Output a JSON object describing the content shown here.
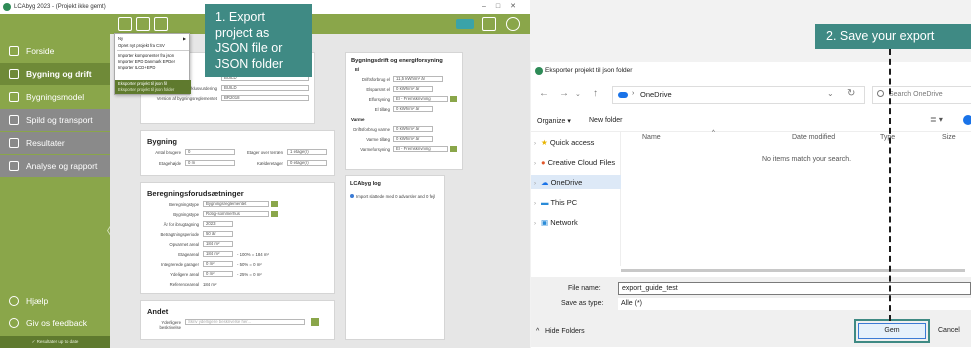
{
  "app": {
    "window_title": "LCAbyg 2023 - (Projekt ikke gemt)",
    "window_controls": [
      "–",
      "□",
      "✕"
    ],
    "sidebar_items": [
      {
        "label": "Forside",
        "icon": "home-icon"
      },
      {
        "label": "Bygning og drift",
        "icon": "building-icon"
      },
      {
        "label": "Bygningsmodel",
        "icon": "model-icon"
      },
      {
        "label": "Spild og transport",
        "icon": "truck-icon"
      },
      {
        "label": "Resultater",
        "icon": "table-icon"
      },
      {
        "label": "Analyse og rapport",
        "icon": "chart-icon"
      }
    ],
    "sidebar_bottom": [
      {
        "label": "Hjælp",
        "icon": "help-icon"
      },
      {
        "label": "Giv os feedback",
        "icon": "feedback-icon"
      }
    ],
    "collapse_glyph": "〈",
    "status_footer": "✓ Resultater up to date",
    "file_menu": {
      "items": [
        "Ny",
        "Opret nyt projekt fra CSV",
        "Importer komponenter fra json",
        "Importer EPD Danmark EPDer",
        "Importer ILCD+EPD",
        "Eksporter projekt til json fil",
        "Eksporter projekt til json folder"
      ]
    },
    "panels": {
      "project": {
        "fields": [
          {
            "label": "",
            "value": "Pilevej 99, 9999 Prombbibyen"
          },
          {
            "label": "",
            "value": "BUILD"
          },
          {
            "label": "Ansvarlig for livscyklusvurdering",
            "value": "BUILD"
          },
          {
            "label": "Version af bygningsreglementet",
            "value": "BR2018"
          }
        ]
      },
      "bygning": {
        "title": "Bygning",
        "fields": [
          {
            "label": "Antal brugere",
            "value": "0"
          },
          {
            "label": "Etager over terræn",
            "value": "1 etage(r)"
          },
          {
            "label": "Etagehøjde",
            "value": "0 m"
          },
          {
            "label": "Kælderetager",
            "value": "0 etage(r)"
          }
        ]
      },
      "beregning": {
        "title": "Beregningsforudsætninger",
        "fields": [
          {
            "label": "Beregningstype",
            "value": "Bygningsreglementet"
          },
          {
            "label": "Bygningstype",
            "value": "Rotig-sommerhus"
          },
          {
            "label": "År for ibrugtagning",
            "value": "2023"
          },
          {
            "label": "Betragtningsperiode",
            "value": "50 år"
          },
          {
            "label": "Opvarmet areal",
            "value": "184 m²"
          },
          {
            "label": "Etageareal",
            "value": "184 m²",
            "note": "- 100% = 184 m²"
          },
          {
            "label": "Integrerede garager",
            "value": "0 m²",
            "note": "- 50% = 0 m²"
          },
          {
            "label": "Ydeligere areal",
            "value": "0 m²",
            "note": "- 25% = 0 m²"
          },
          {
            "label": "Referenceareal",
            "value": "184 m²"
          }
        ]
      },
      "andet": {
        "title": "Andet",
        "label": "Yderligere beskrivelse",
        "placeholder": "Skriv yderligere beskrivelse her..."
      },
      "energi": {
        "title": "Bygningsdrift og energiforsyning",
        "el_heading": "El",
        "varme_heading": "Varme",
        "el_fields": [
          {
            "label": "Driftsforbrug el",
            "value": "11,5 kWh/m² år"
          },
          {
            "label": "Elsparsmt el",
            "value": "0 kWh/m² år"
          },
          {
            "label": "Elforsyning",
            "value": "El - Fremskrivning"
          },
          {
            "label": "El tillæg",
            "value": "0 kWh/m² år"
          }
        ],
        "varme_fields": [
          {
            "label": "Driftsforbrug varme",
            "value": "0 kWh/m² år"
          },
          {
            "label": "Varme tillæg",
            "value": "0 kWh/m² år"
          },
          {
            "label": "Varmeforsyning",
            "value": "El - Fremskrivning"
          }
        ]
      },
      "log": {
        "title": "LCAbyg log",
        "entries": [
          "Import slattede med 0 advarsler and 0 fejl"
        ]
      }
    }
  },
  "callouts": {
    "step1": [
      "1. Export",
      "project as",
      "JSON file or",
      "JSON folder"
    ],
    "step2": "2. Save your export"
  },
  "dialog": {
    "title": "Eksporter projekt til json folder",
    "address": "OneDrive",
    "search_placeholder": "Search OneDrive",
    "organize_label": "Organize ▾",
    "new_folder_label": "New folder",
    "tree": [
      "Quick access",
      "Creative Cloud Files",
      "OneDrive",
      "This PC",
      "Network"
    ],
    "columns": [
      "Name",
      "Date modified",
      "Type",
      "Size"
    ],
    "empty_message": "No items match your search.",
    "file_name_label": "File name:",
    "file_name_value": "export_guide_test",
    "save_type_label": "Save as type:",
    "save_type_value": "Alle  (*)",
    "hide_folders_label": "Hide Folders",
    "save_button": "Gem",
    "cancel_button": "Cancel"
  }
}
